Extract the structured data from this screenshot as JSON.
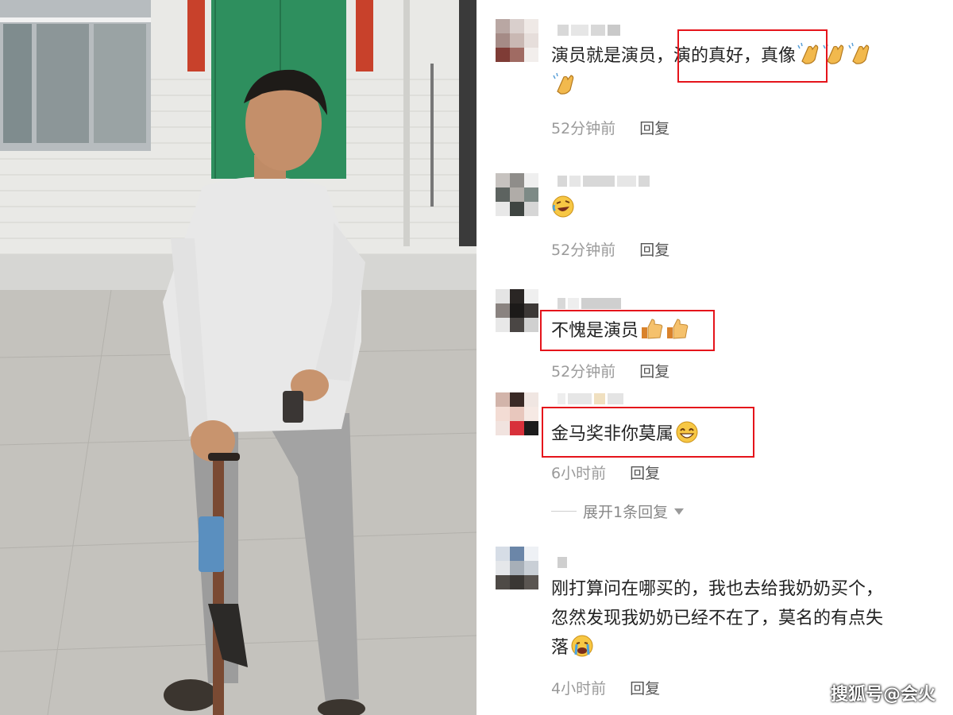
{
  "comments": [
    {
      "text": "演员就是演员，演的真好，真像",
      "time": "52分钟前",
      "reply_label": "回复",
      "emoji": [
        "clap-icon",
        "clap-icon",
        "clap-icon",
        "clap-icon"
      ]
    },
    {
      "text": "",
      "time": "52分钟前",
      "reply_label": "回复",
      "emoji": [
        "rofl-icon"
      ]
    },
    {
      "text": "不愧是演员",
      "time": "52分钟前",
      "reply_label": "回复",
      "emoji": [
        "thumbs-up-icon",
        "thumbs-up-icon"
      ]
    },
    {
      "text": "金马奖非你莫属",
      "time": "6小时前",
      "reply_label": "回复",
      "emoji": [
        "grin-icon"
      ]
    },
    {
      "text_line1": "刚打算问在哪买的，我也去给我奶奶买个，",
      "text_line2": "忽然发现我奶奶已经不在了，莫名的有点失",
      "text_line3": "落",
      "time": "4小时前",
      "reply_label": "回复",
      "emoji": [
        "crying-icon"
      ]
    }
  ],
  "expand_replies": "展开1条回复",
  "watermark": "搜狐号@会火",
  "colors": {
    "highlight_box": "#e5141b",
    "meta_text": "#9a9a9a",
    "body_text": "#222222"
  }
}
